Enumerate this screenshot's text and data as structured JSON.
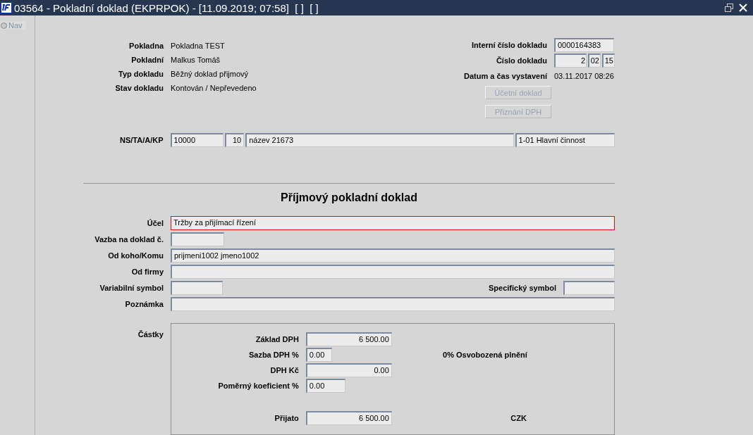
{
  "window": {
    "title": "03564 - Pokladní doklad (EKPRPOK) - [11.09.2019; 07:58]  [ ]  [ ]"
  },
  "nav": {
    "label": "Nav",
    "selected": false
  },
  "header": {
    "left": [
      {
        "label": "Pokladna",
        "value": "Pokladna TEST"
      },
      {
        "label": "Pokladní",
        "value": "Malkus Tomáš"
      },
      {
        "label": "Typ dokladu",
        "value": "Běžný doklad přijmový"
      },
      {
        "label": "Stav dokladu",
        "value": "Kontován / Nepřevedeno"
      }
    ],
    "internal_number": {
      "label": "Interní číslo dokladu",
      "value": "0000164383"
    },
    "document_number": {
      "label": "Číslo dokladu",
      "parts": [
        "2",
        "02",
        "15"
      ]
    },
    "issued": {
      "label": "Datum a čas vystavení",
      "value": "03.11.2017 08:26"
    },
    "buttons": [
      {
        "label": "Účetní doklad",
        "disabled": true
      },
      {
        "label": "Přiznání DPH",
        "disabled": true
      }
    ]
  },
  "account": {
    "label": "NS/TA/A/KP",
    "fields": [
      "10000",
      "10",
      "název 21673",
      "1-01 Hlavní činnost"
    ]
  },
  "heading": "Příjmový pokladní doklad",
  "form": [
    {
      "kind": "wide",
      "label": "Účel",
      "value": "Tržby za přijímací řízení",
      "focused": true
    },
    {
      "kind": "short",
      "label": "Vazba na doklad č.",
      "focused": false
    },
    {
      "kind": "wide",
      "label": "Od koho/Komu",
      "value": "prijmeni1002 jmeno1002",
      "focused": false
    },
    {
      "kind": "wide",
      "label": "Od firmy",
      "focused": false
    },
    {
      "kind": "pair",
      "label": "Variabilní symbol",
      "right_label": "Specifický symbol",
      "focused": false
    },
    {
      "kind": "wide",
      "label": "Poznámka",
      "focused": false
    }
  ],
  "amounts": {
    "label": "Částky",
    "rows": [
      {
        "kind": "wide",
        "label": "Základ DPH",
        "value": "6 500.00"
      },
      {
        "kind": "rate",
        "label": "Sazba DPH %",
        "value": "0.00",
        "note": "0% Osvobozená plnění"
      },
      {
        "kind": "wide",
        "label": "DPH Kč",
        "value": "0.00"
      },
      {
        "kind": "coef",
        "label": "Poměrný koeficient %",
        "value": "0.00"
      },
      {
        "kind": "total",
        "label": "Přijato",
        "value": "6 500.00",
        "currency": "CZK"
      }
    ]
  }
}
